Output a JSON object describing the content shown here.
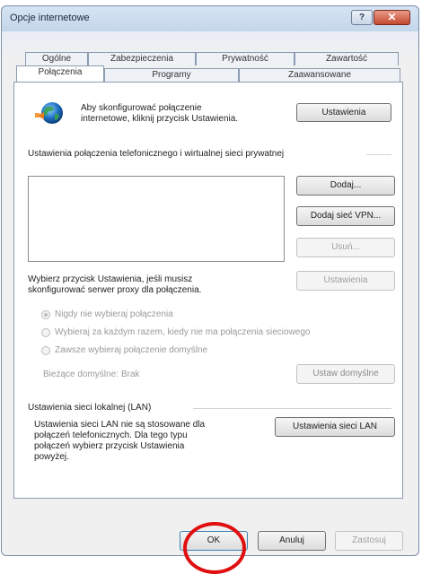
{
  "window": {
    "title": "Opcje internetowe",
    "help_glyph": "?",
    "close_glyph": "✕"
  },
  "tabs": {
    "row1": [
      "Ogólne",
      "Zabezpieczenia",
      "Prywatność",
      "Zawartość"
    ],
    "row2": [
      "Połączenia",
      "Programy",
      "Zaawansowane"
    ],
    "active": "Połączenia"
  },
  "setup": {
    "text_line1": "Aby skonfigurować połączenie",
    "text_line2": "internetowe, kliknij przycisk Ustawienia.",
    "button": "Ustawienia",
    "icon": "globe-network-icon"
  },
  "dialup": {
    "group_title": "Ustawienia połączenia telefonicznego i wirtualnej sieci prywatnej",
    "add_button": "Dodaj...",
    "add_vpn_button": "Dodaj sieć VPN...",
    "remove_button": "Usuń...",
    "settings_text_line1": "Wybierz przycisk Ustawienia, jeśli musisz",
    "settings_text_line2": "skonfigurować serwer proxy dla połączenia.",
    "settings_button": "Ustawienia",
    "options": [
      "Nigdy nie wybieraj połączenia",
      "Wybieraj za każdym razem, kiedy nie ma połączenia sieciowego",
      "Zawsze wybieraj połączenie domyślne"
    ],
    "selected_option": 0,
    "current_default_label": "Bieżące domyślne:",
    "current_default_value": "Brak",
    "set_default_button": "Ustaw domyślne"
  },
  "lan": {
    "group_title": "Ustawienia sieci lokalnej (LAN)",
    "text_lines": [
      "Ustawienia sieci LAN nie są stosowane dla",
      "połączeń telefonicznych. Dla tego typu",
      "połączeń wybierz przycisk Ustawienia",
      "powyżej."
    ],
    "button": "Ustawienia sieci LAN"
  },
  "footer": {
    "ok": "OK",
    "cancel": "Anuluj",
    "apply": "Zastosuj"
  },
  "colors": {
    "highlight_circle": "#e01010",
    "title_bar": "#c4d6ea"
  }
}
